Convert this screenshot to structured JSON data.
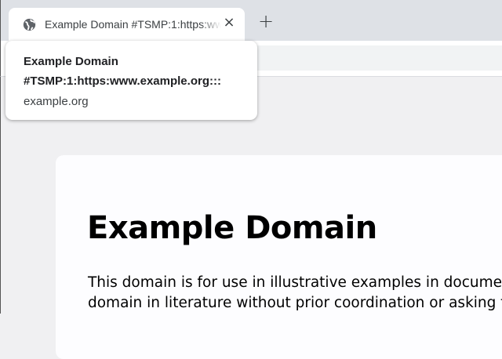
{
  "tab": {
    "title": "Example Domain #TSMP:1:https:www.example.org:::",
    "close_icon": "×",
    "icon": "globe-icon"
  },
  "new_tab_label": "+",
  "tooltip": {
    "title_line1": "Example Domain",
    "title_line2": "#TSMP:1:https:www.example.org:::",
    "url": "example.org"
  },
  "page": {
    "heading": "Example Domain",
    "paragraph_lines": [
      "This domain is for use in illustrative examples in documen",
      "domain in literature without prior coordination or asking f"
    ]
  }
}
